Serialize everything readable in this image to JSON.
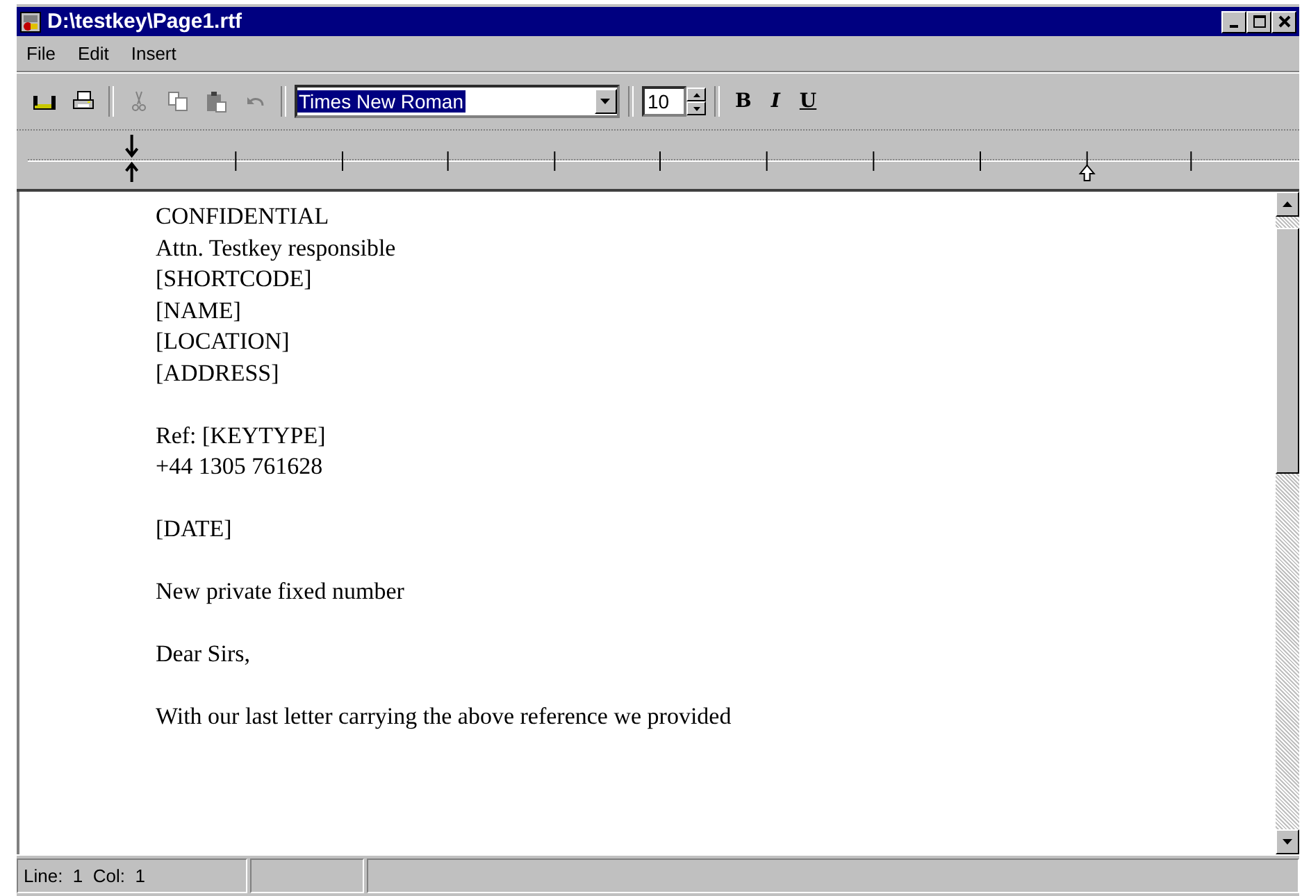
{
  "window": {
    "title": "D:\\testkey\\Page1.rtf"
  },
  "menu": [
    "File",
    "Edit",
    "Insert"
  ],
  "toolbar": {
    "buttons": [
      {
        "kind": "save",
        "disabled": false
      },
      {
        "kind": "print",
        "disabled": false
      },
      {
        "kind": "cut",
        "disabled": true
      },
      {
        "kind": "copy",
        "disabled": true
      },
      {
        "kind": "paste",
        "disabled": true
      },
      {
        "kind": "undo",
        "disabled": true
      }
    ],
    "font": {
      "value": "Times New Roman",
      "selected": true
    },
    "size": {
      "value": "10"
    },
    "format": [
      {
        "kind": "bold",
        "label": "B"
      },
      {
        "kind": "italic",
        "label": "I"
      },
      {
        "kind": "underline",
        "label": "U"
      }
    ]
  },
  "document": {
    "blocks": [
      [
        "CONFIDENTIAL",
        "Attn. Testkey responsible",
        "[SHORTCODE]",
        "[NAME]",
        "[LOCATION]",
        "[ADDRESS]"
      ],
      [
        "Ref: [KEYTYPE]",
        "+44 1305 761628"
      ],
      [
        "[DATE]"
      ],
      [
        "New private fixed number"
      ],
      [
        "Dear Sirs,"
      ],
      [
        "With our last letter carrying the above reference we provided"
      ]
    ]
  },
  "status_bar": [
    "Line:  1  Col:  1"
  ]
}
